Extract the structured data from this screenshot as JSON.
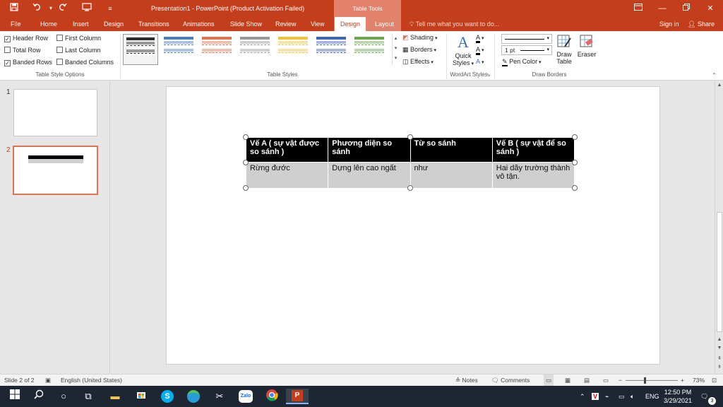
{
  "window": {
    "title": "Presentation1 - PowerPoint (Product Activation Failed)",
    "context_tab_group": "Table Tools",
    "controls": [
      "restore-ribbon",
      "minimize",
      "maximize",
      "close"
    ]
  },
  "quick_access": {
    "icons": [
      "save-icon",
      "undo-icon",
      "redo-icon",
      "presentation-icon",
      "customize-icon"
    ]
  },
  "tabs": {
    "file": "File",
    "home": "Home",
    "insert": "Insert",
    "design": "Design",
    "transitions": "Transitions",
    "animations": "Animations",
    "slideshow": "Slide Show",
    "review": "Review",
    "view": "View",
    "tt_design": "Design",
    "tt_layout": "Layout",
    "tellme": "Tell me what you want to do...",
    "signin": "Sign in",
    "share": "Share"
  },
  "ribbon": {
    "table_style_options": {
      "label": "Table Style Options",
      "header_row": "Header Row",
      "first_column": "First Column",
      "total_row": "Total Row",
      "last_column": "Last Column",
      "banded_rows": "Banded Rows",
      "banded_columns": "Banded Columns",
      "checked": {
        "header_row": true,
        "first_column": false,
        "total_row": false,
        "last_column": false,
        "banded_rows": true,
        "banded_columns": false
      }
    },
    "table_styles": {
      "label": "Table Styles",
      "swatches": [
        "#2b2b2b",
        "#4a7ebb",
        "#e0734f",
        "#999999",
        "#f0c23b",
        "#3f63b8",
        "#6aa84f"
      ],
      "shading": "Shading",
      "borders": "Borders",
      "effects": "Effects"
    },
    "wordart": {
      "label": "WordArt Styles",
      "quick_styles_line1": "Quick",
      "quick_styles_line2": "Styles"
    },
    "draw_borders": {
      "label": "Draw Borders",
      "pen_weight": "1 pt",
      "pen_color": "Pen Color",
      "draw_table_line1": "Draw",
      "draw_table_line2": "Table",
      "eraser": "Eraser"
    }
  },
  "slides_panel": {
    "slide1_num": "1",
    "slide2_num": "2",
    "selected": 2
  },
  "table": {
    "headers": [
      "Vế A ( sự vật được so sánh )",
      "Phương diện so sánh",
      "Từ so sánh",
      "Vế B ( sự vật để so sánh )"
    ],
    "row": [
      "Rừng đước",
      "Dựng lên cao ngất",
      "như",
      "Hai dãy trường thành vô tận."
    ]
  },
  "statusbar": {
    "slide_info": "Slide 2 of 2",
    "language": "English (United States)",
    "notes": "Notes",
    "comments": "Comments",
    "zoom": "73%"
  },
  "taskbar": {
    "language": "ENG",
    "time": "12:50 PM",
    "date": "3/29/2021",
    "notification_count": "3"
  },
  "colors": {
    "accent": "#c43e1c",
    "context_tab": "#e3826a",
    "selected_thumb": "#e0734f"
  }
}
